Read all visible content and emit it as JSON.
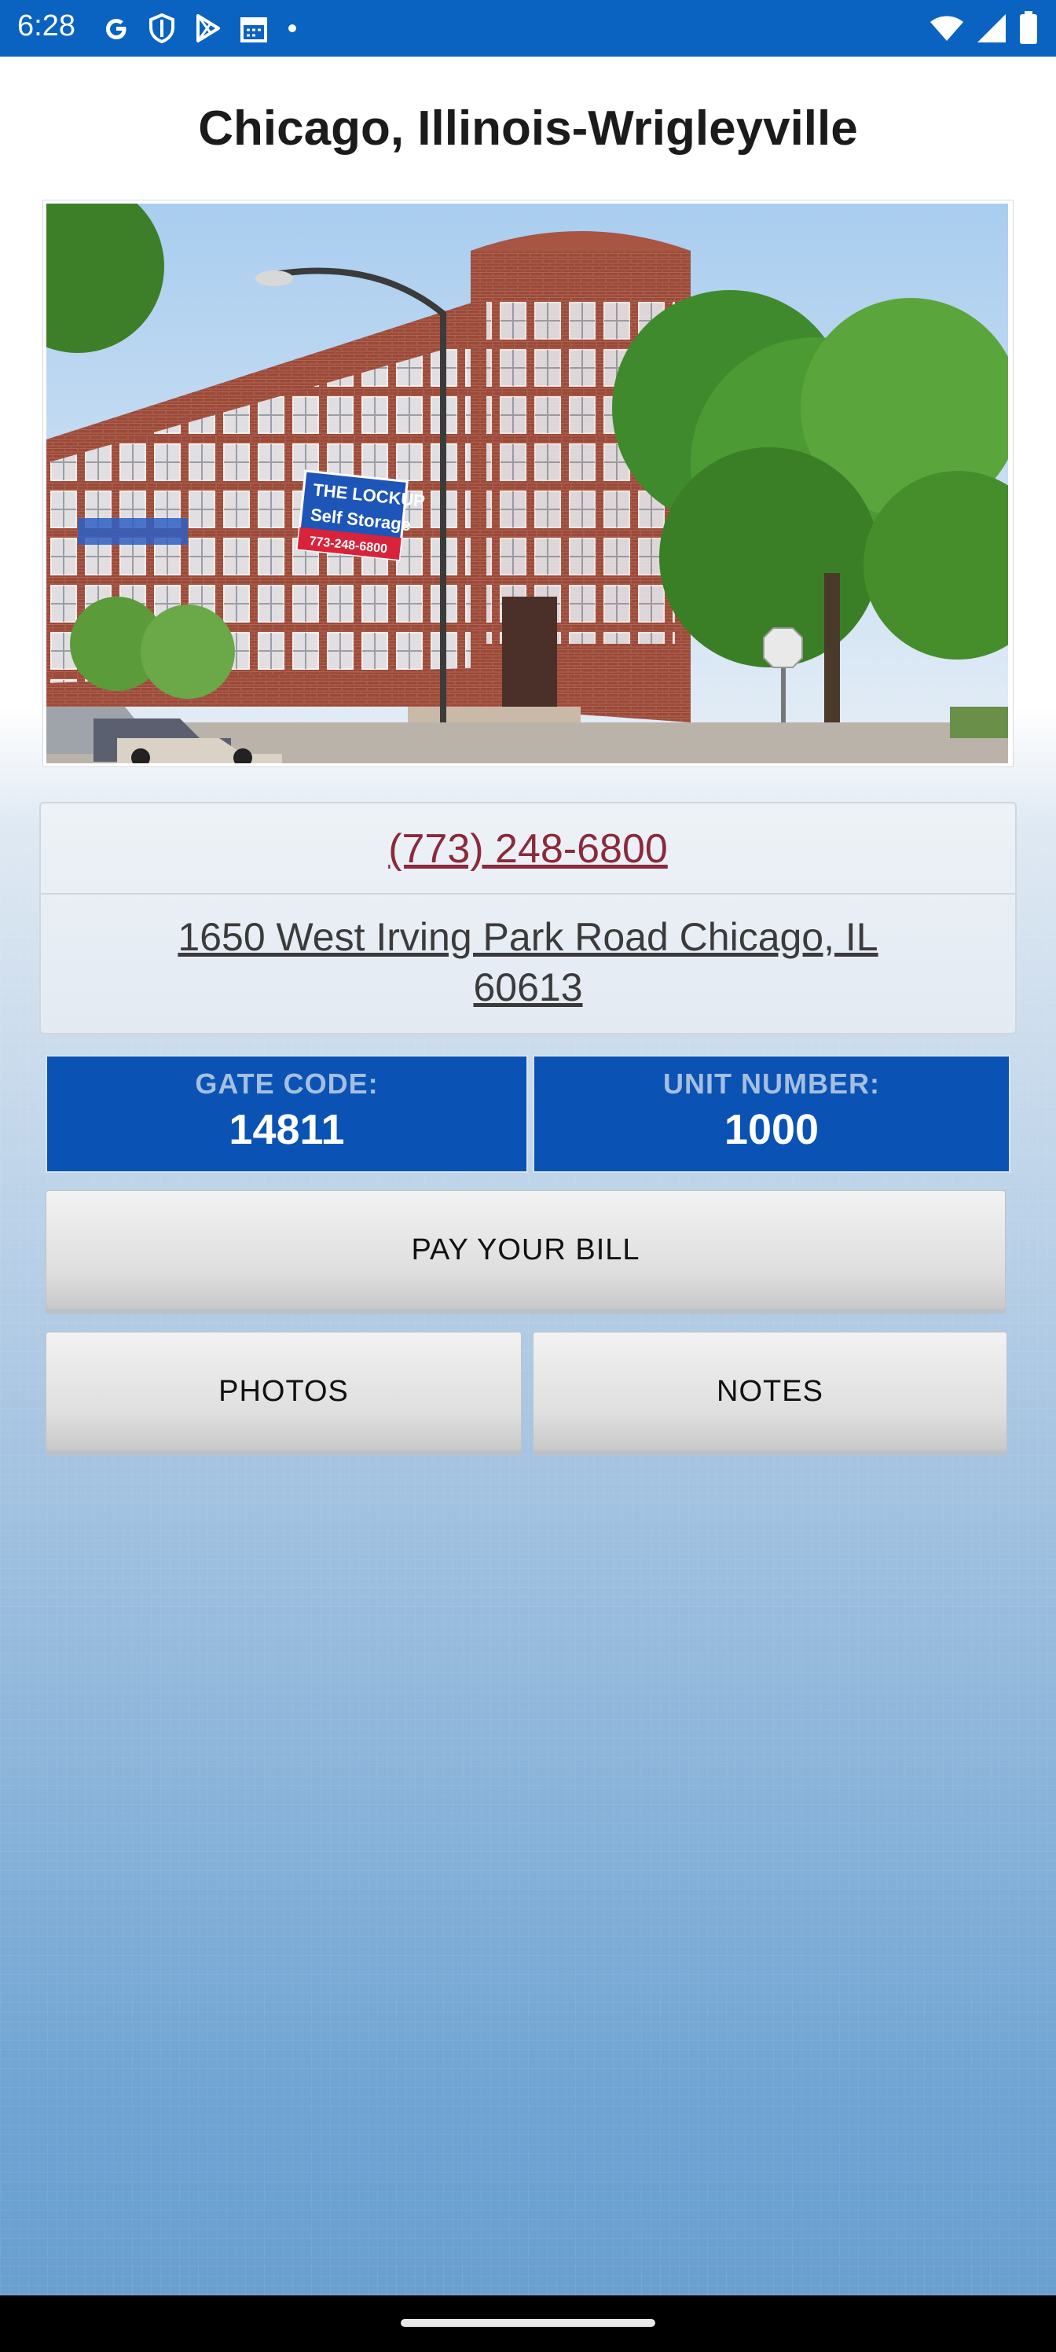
{
  "status_bar": {
    "time": "6:28",
    "left_icons": [
      "google-icon",
      "shield-icon",
      "play-store-icon",
      "calendar-icon",
      "dot-icon"
    ],
    "right_icons": [
      "wifi-icon",
      "signal-icon",
      "battery-icon"
    ],
    "background_color": "#0a63c1"
  },
  "page": {
    "title": "Chicago, Illinois-Wrigleyville"
  },
  "photo": {
    "sign_text": "THE LOCKUP",
    "sign_sub": "Self Storage",
    "sign_phone": "773-248-6800",
    "building_number": "248-6800"
  },
  "contact": {
    "phone": "(773) 248-6800",
    "address": "1650 West Irving Park Road Chicago, IL 60613"
  },
  "codes": {
    "gate_label": "GATE CODE:",
    "gate_value": "14811",
    "unit_label": "UNIT NUMBER:",
    "unit_value": "1000"
  },
  "buttons": {
    "pay_bill": "PAY YOUR BILL",
    "photos": "PHOTOS",
    "notes": "NOTES"
  },
  "colors": {
    "tile_blue": "#0a53b5",
    "phone_link": "#8b2a3b",
    "title_text": "#1b1b1b"
  }
}
